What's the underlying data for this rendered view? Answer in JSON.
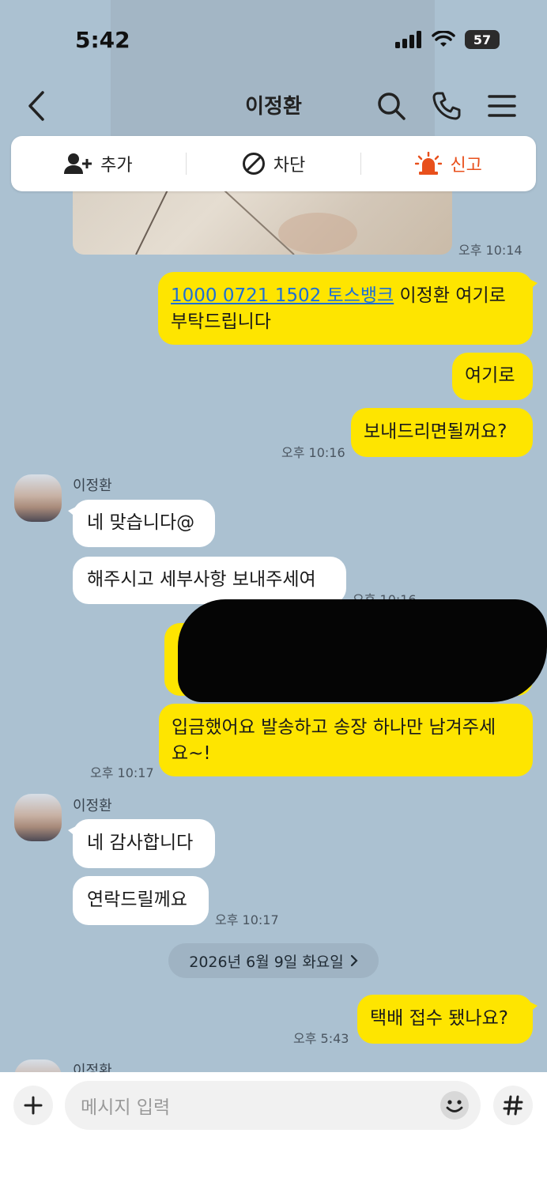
{
  "status_bar": {
    "time": "5:42",
    "battery": "57"
  },
  "header": {
    "title": "이정환"
  },
  "action_bar": {
    "add": "추가",
    "block": "차단",
    "report": "신고"
  },
  "messages": {
    "photo_time": "오후 10:14",
    "m1_link": "1000 0721 1502 토스뱅크",
    "m1_rest": " 이정환 여기로",
    "m1_line2": "부탁드립니다",
    "m2": "여기로",
    "m3": "보내드리면될꺼요?",
    "m3_time": "오후 10:16",
    "sender_name": "이정환",
    "r1": "네 맞습니다@",
    "r2": "해주시고 세부사항 보내주세여",
    "r2_time": "오후 10:16",
    "m4_line1": "입금했어요 발송하고 송장 하나만 남겨주세",
    "m4_line2": "요~!",
    "m4_time": "오후 10:17",
    "r3": "네 감사합니다",
    "r4": "연락드릴께요",
    "r4_time": "오후 10:17",
    "date_divider": "2026년 6월 9일 화요일",
    "m5": "택배 접수 됐나요?",
    "m5_time": "오후 5:43"
  },
  "composer": {
    "placeholder": "메시지 입력"
  },
  "icons": [
    "back-icon",
    "search-icon",
    "phone-icon",
    "menu-icon",
    "add-friend-icon",
    "block-icon",
    "siren-icon",
    "plus-icon",
    "emoji-icon",
    "hash-icon"
  ],
  "colors": {
    "background": "#abc1d1",
    "my_bubble": "#fee500",
    "their_bubble": "#ffffff",
    "report": "#e8501c",
    "link": "#1d6fd6"
  }
}
